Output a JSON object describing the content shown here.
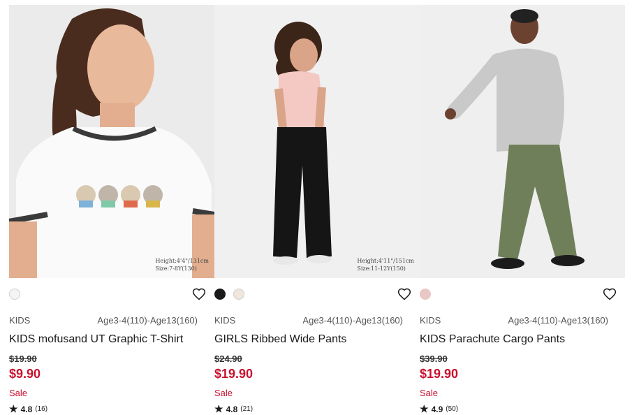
{
  "colors": {
    "accent": "#c8102e",
    "text": "#1b1b1b"
  },
  "products": [
    {
      "image_alt": "Girl wearing white ringer T-shirt with bear print",
      "size_note_line1": "Height:4'4\"/131cm",
      "size_note_line2": "Size:7-8Y(130)",
      "swatches": [
        "#f4f4f4"
      ],
      "gender": "KIDS",
      "sizes": "Age3-4(110)-Age13(160)",
      "name": "KIDS mofusand UT Graphic T-Shirt",
      "original_price": "$19.90",
      "price": "$9.90",
      "sale_label": "Sale",
      "rating": "4.8",
      "review_count": "(16)"
    },
    {
      "image_alt": "Girl wearing pink top and black ribbed wide pants",
      "size_note_line1": "Height:4'11\"/151cm",
      "size_note_line2": "Size:11-12Y(150)",
      "swatches": [
        "#1a1a1a",
        "#efe6dc"
      ],
      "gender": "KIDS",
      "sizes": "Age3-4(110)-Age13(160)",
      "name": "GIRLS Ribbed Wide Pants",
      "original_price": "$24.90",
      "price": "$19.90",
      "sale_label": "Sale",
      "rating": "4.8",
      "review_count": "(21)"
    },
    {
      "image_alt": "Boy wearing gray sweatshirt and olive parachute cargo pants",
      "swatches": [
        "#e9c7c4"
      ],
      "gender": "KIDS",
      "sizes": "Age3-4(110)-Age13(160)",
      "name": "KIDS Parachute Cargo Pants",
      "original_price": "$39.90",
      "price": "$19.90",
      "sale_label": "Sale",
      "rating": "4.9",
      "review_count": "(50)"
    }
  ]
}
